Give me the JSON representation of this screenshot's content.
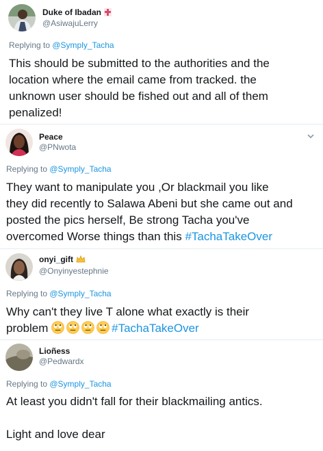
{
  "tweets": [
    {
      "name": "Duke of Ibadan",
      "handle": "@AsiwajuLerry",
      "replying_prefix": "Replying to ",
      "replying_to": "@Symply_Tacha",
      "lines": [
        "This should be submitted to the authorities and the",
        "location where the email came from tracked. the",
        "unknown user should be fished out and all of them",
        "penalized!"
      ],
      "badge_icon": "cross-badge-icon"
    },
    {
      "name": "Peace",
      "handle": "@PNwota",
      "replying_prefix": "Replying to ",
      "replying_to": "@Symply_Tacha",
      "lines": [
        "They want to manipulate you ,Or blackmail you like",
        "they did recently to Salawa Abeni but she came out and",
        "posted the pics herself, Be strong Tacha you've"
      ],
      "last_line_text": "overcomed Worse things than this ",
      "hashtag": "#TachaTakeOver",
      "menu_icon": "chevron-down-icon"
    },
    {
      "name": "onyi_gift",
      "handle": "@Onyinyestephnie",
      "replying_prefix": "Replying to ",
      "replying_to": "@Symply_Tacha",
      "line1": "Why can't they live T alone what exactly is their",
      "line2_text": "problem ",
      "emoji_count": 4,
      "emoji_icon": "rolling-eyes-emoji",
      "hashtag": "#TachaTakeOver",
      "badge_icon": "crown-icon"
    },
    {
      "name": "Lioñess",
      "handle": "@Pedwardx",
      "replying_prefix": "Replying to ",
      "replying_to": "@Symply_Tacha",
      "line1": "At least you didn't fall for their blackmailing antics.",
      "line2": "Light and love dear"
    }
  ],
  "colors": {
    "text": "#14171a",
    "secondary": "#657786",
    "link": "#1b95e0",
    "divider": "#e6ecf0"
  }
}
